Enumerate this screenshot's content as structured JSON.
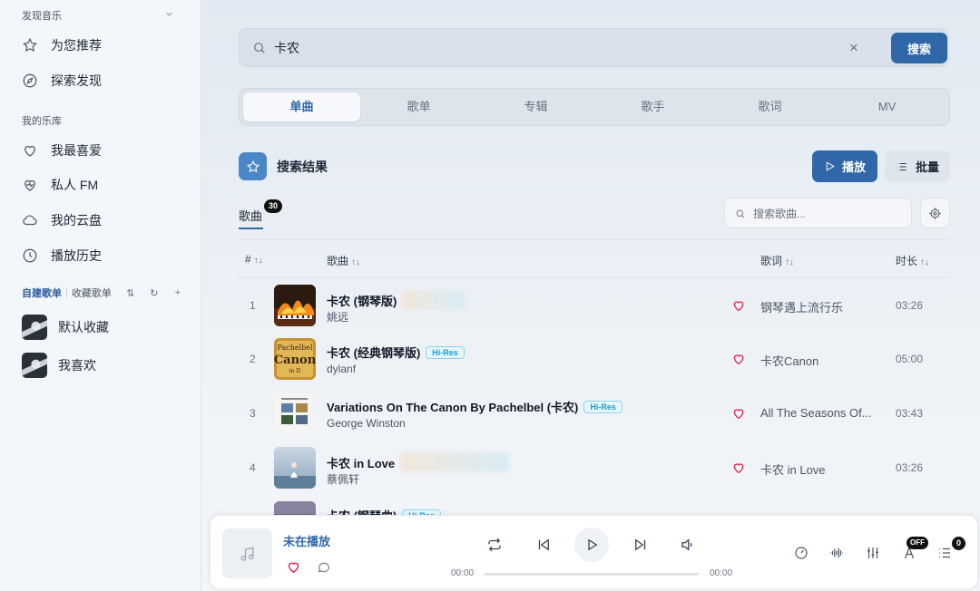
{
  "sidebar": {
    "discover_section": "发现音乐",
    "discover_items": [
      {
        "label": "为您推荐",
        "icon": "star-icon"
      },
      {
        "label": "探索发现",
        "icon": "compass-icon"
      }
    ],
    "library_section": "我的乐库",
    "library_items": [
      {
        "label": "我最喜爱",
        "icon": "heart-icon"
      },
      {
        "label": "私人 FM",
        "icon": "radio-heart-icon"
      },
      {
        "label": "我的云盘",
        "icon": "cloud-icon"
      },
      {
        "label": "播放历史",
        "icon": "clock-icon"
      }
    ],
    "playlist_tabs": {
      "created": "自建歌单",
      "collected": "收藏歌单"
    },
    "playlists": [
      {
        "label": "默认收藏"
      },
      {
        "label": "我喜欢"
      }
    ]
  },
  "search": {
    "value": "卡农",
    "clear_label": "×",
    "button_label": "搜索"
  },
  "tabs": [
    {
      "label": "单曲",
      "active": true
    },
    {
      "label": "歌单",
      "active": false
    },
    {
      "label": "专辑",
      "active": false
    },
    {
      "label": "歌手",
      "active": false
    },
    {
      "label": "歌词",
      "active": false
    },
    {
      "label": "MV",
      "active": false
    }
  ],
  "results": {
    "title": "搜索结果",
    "play_label": "播放",
    "batch_label": "批量",
    "subtab_label": "歌曲",
    "count": "30",
    "filter_placeholder": "搜索歌曲..."
  },
  "table": {
    "headers": {
      "index": "#",
      "song": "歌曲",
      "lyric": "歌词",
      "duration": "时长"
    },
    "sort_glyph": "↑↓",
    "rows": [
      {
        "index": "1",
        "title": "卡农 (钢琴版)",
        "hires": "",
        "artist": "姚远",
        "lyric": "钢琴遇上流行乐",
        "duration": "03:26"
      },
      {
        "index": "2",
        "title": "卡农 (经典钢琴版)",
        "hires": "Hi-Res",
        "artist": "dylanf",
        "lyric": "卡农Canon",
        "duration": "05:00"
      },
      {
        "index": "3",
        "title": "Variations On The Canon By Pachelbel (卡农)",
        "hires": "Hi-Res",
        "artist": "George Winston",
        "lyric": "All The Seasons Of...",
        "duration": "03:43"
      },
      {
        "index": "4",
        "title": "卡农 in Love",
        "hires": "",
        "artist": "蔡佩轩",
        "lyric": "卡农 in Love",
        "duration": "03:26"
      },
      {
        "index": "",
        "title": "卡农 (钢琴曲)",
        "hires": "Hi-Res",
        "artist": "",
        "lyric": "",
        "duration": ""
      }
    ]
  },
  "player": {
    "title": "未在播放",
    "time_current": "00:00",
    "time_total": "00:00",
    "progress": 0,
    "lyrics_badge": "OFF",
    "queue_count": "0"
  },
  "colors": {
    "accent": "#2f67a8",
    "heart": "#e11d48",
    "hires": "#1d9bd1"
  }
}
